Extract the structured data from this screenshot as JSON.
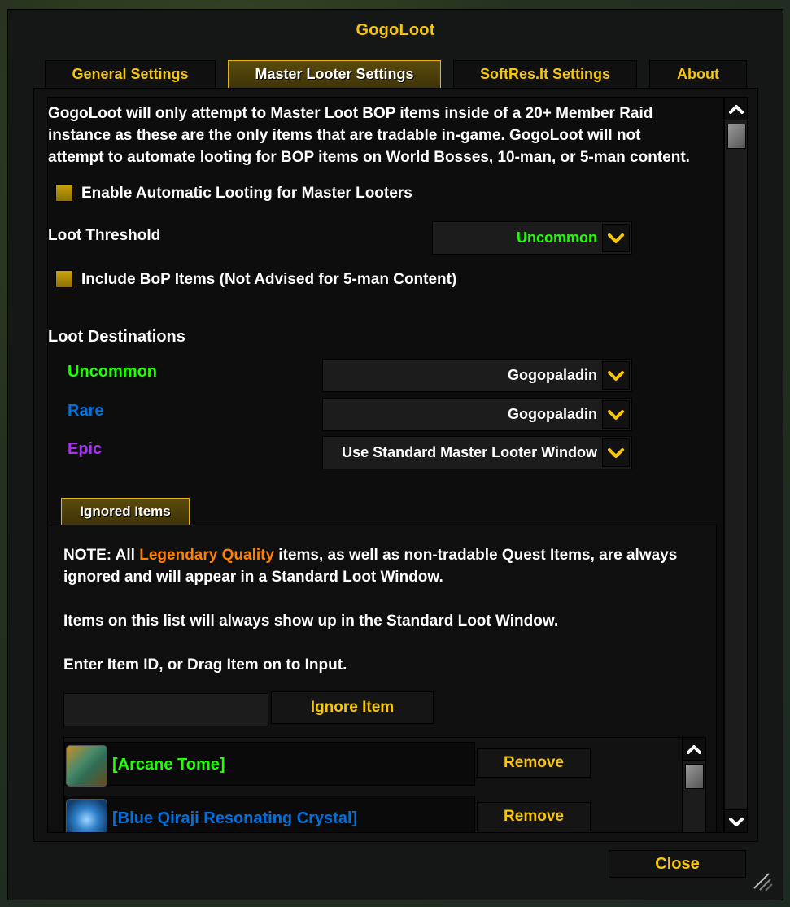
{
  "window": {
    "title": "GogoLoot"
  },
  "tabs": [
    {
      "label": "General Settings",
      "active": false
    },
    {
      "label": "Master Looter Settings",
      "active": true
    },
    {
      "label": "SoftRes.It Settings",
      "active": false
    },
    {
      "label": "About",
      "active": false
    }
  ],
  "master_looter": {
    "intro_lines": [
      "GogoLoot will only attempt to Master Loot BOP items inside of a 20+ Member Raid",
      "instance as these are the only items that are tradable in-game. GogoLoot will not",
      "attempt to automate looting for BOP items on World Bosses, 10-man, or 5-man content."
    ],
    "enable_auto_looting": {
      "label": "Enable Automatic Looting for Master Looters",
      "checked": true
    },
    "loot_threshold": {
      "label": "Loot Threshold",
      "value": "Uncommon",
      "value_color": "#1eff00"
    },
    "include_bop": {
      "label": "Include BoP Items (Not Advised for 5-man Content)",
      "checked": true
    },
    "loot_destinations": {
      "heading": "Loot Destinations",
      "rows": [
        {
          "quality": "Uncommon",
          "color": "#1eff00",
          "value": "Gogopaladin"
        },
        {
          "quality": "Rare",
          "color": "#0070dd",
          "value": "Gogopaladin"
        },
        {
          "quality": "Epic",
          "color": "#a335ee",
          "value": "Use Standard Master Looter Window"
        }
      ]
    }
  },
  "ignored_items": {
    "tab_label": "Ignored Items",
    "note_prefix": "NOTE: All ",
    "note_highlight": "Legendary Quality",
    "note_highlight_color": "#ff8000",
    "note_suffix": " items, as well as non-tradable Quest Items, are always",
    "note_line2": "ignored and will appear in a Standard Loot Window.",
    "list_info": "Items on this list will always show up in the Standard Loot Window.",
    "input_hint": "Enter Item ID, or Drag Item on to Input.",
    "item_input": {
      "value": "",
      "placeholder": ""
    },
    "ignore_button": "Ignore Item",
    "items": [
      {
        "name": "[Arcane Tome]",
        "color": "#1eff00",
        "icon": "arcane-tome-icon",
        "remove_label": "Remove"
      },
      {
        "name": "[Blue Qiraji Resonating Crystal]",
        "color": "#0070dd",
        "icon": "blue-qiraji-crystal-icon",
        "remove_label": "Remove"
      }
    ]
  },
  "footer": {
    "close_label": "Close"
  },
  "colors": {
    "accent_gold": "#f5c60b",
    "uncommon": "#1eff00",
    "rare": "#0070dd",
    "epic": "#a335ee",
    "legendary": "#ff8000"
  }
}
